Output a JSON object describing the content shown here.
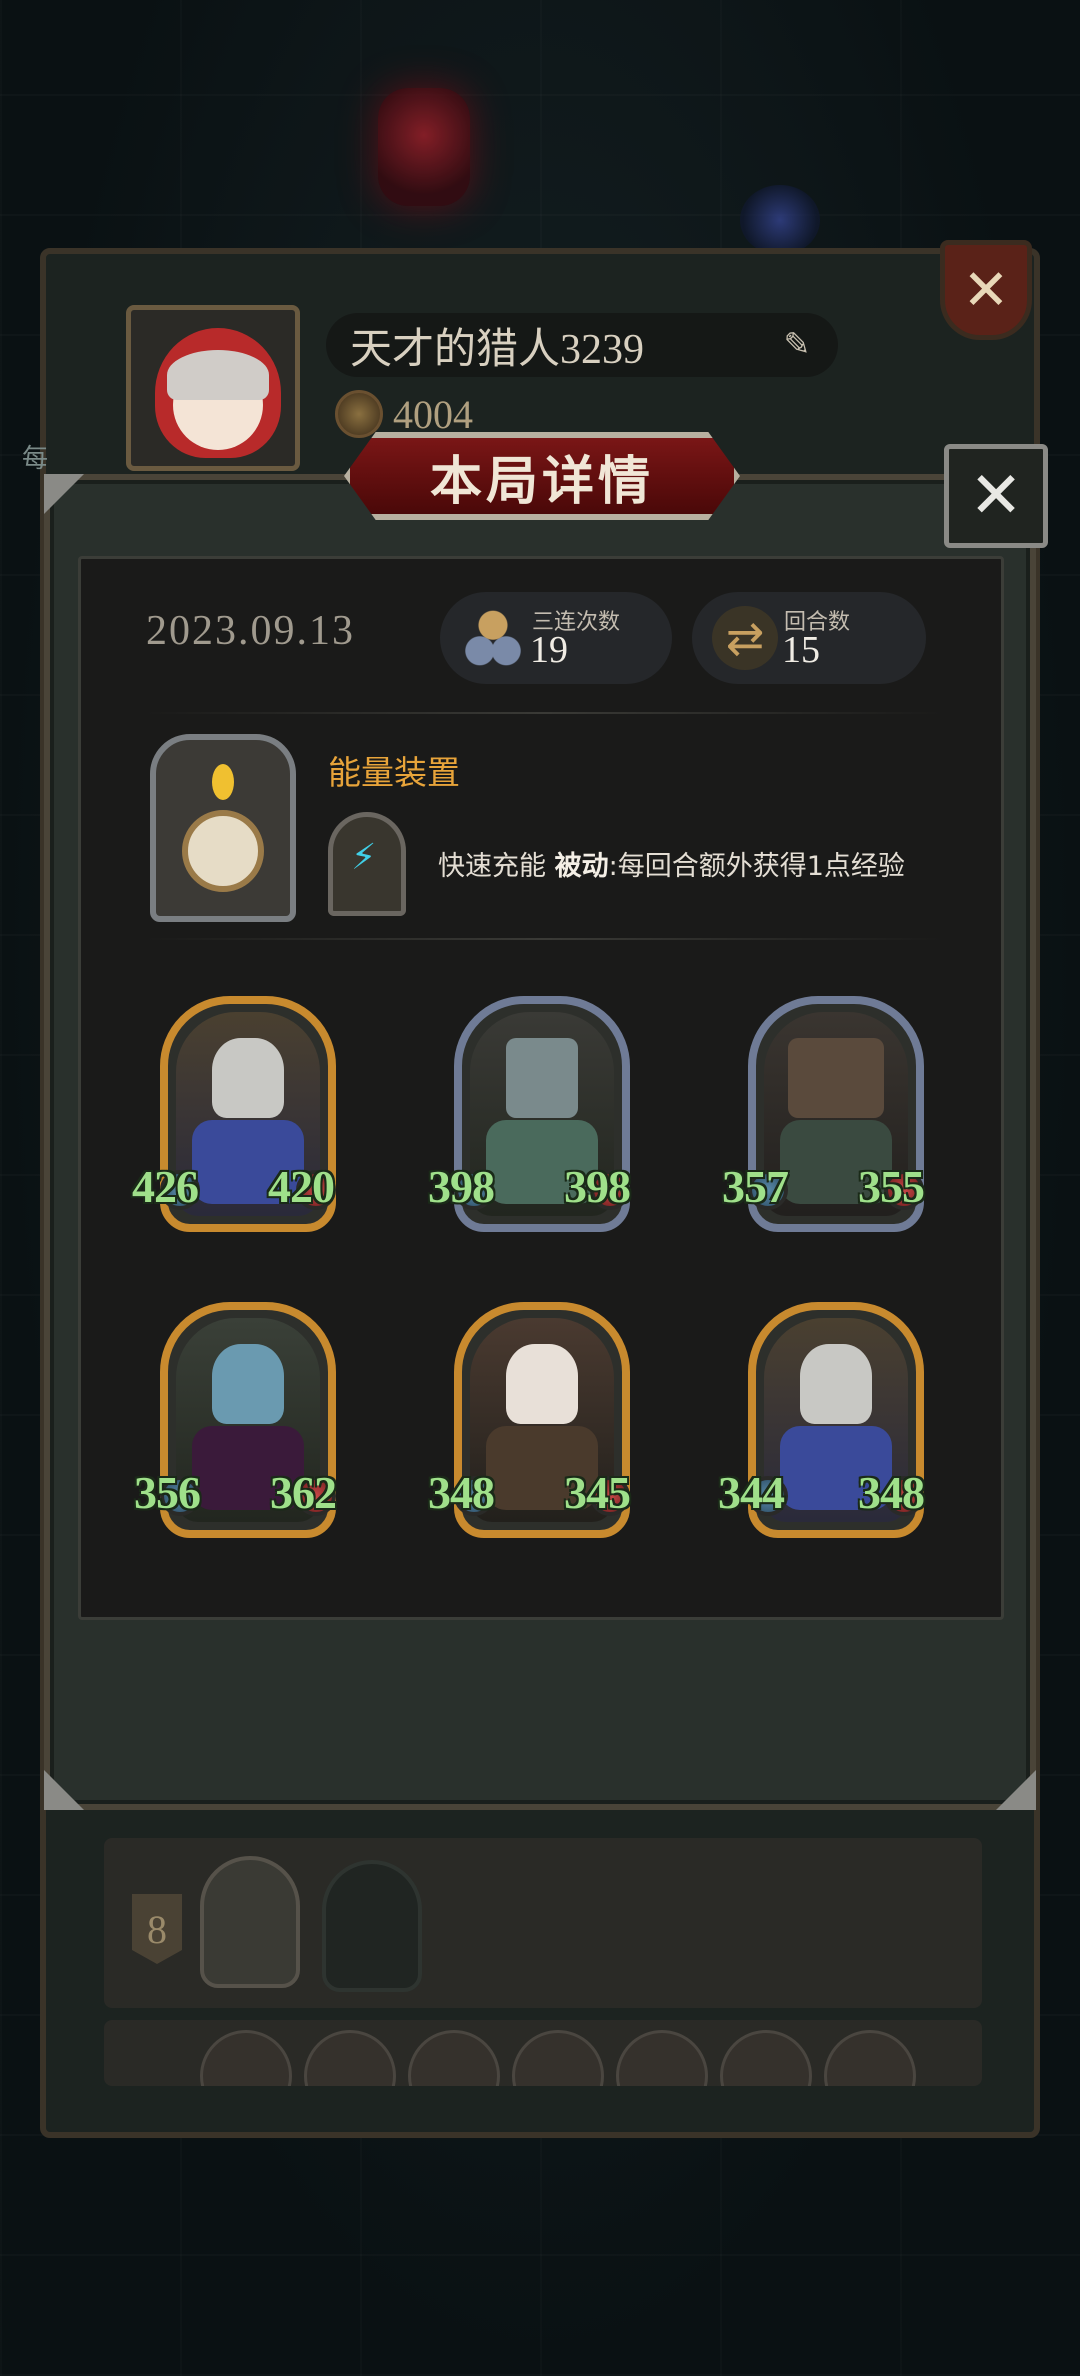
{
  "profile": {
    "player_name": "天才的猎人3239",
    "coins": "4004",
    "side_hint": "每"
  },
  "dialog": {
    "title": "本局详情",
    "date": "2023.09.13",
    "stats": [
      {
        "label": "三连次数",
        "value": "19",
        "icon": "triple-merge-icon"
      },
      {
        "label": "回合数",
        "value": "15",
        "icon": "round-cycle-icon"
      }
    ],
    "device": {
      "title": "能量装置",
      "skill_name": "快速充能",
      "skill_type": "被动",
      "skill_desc": ":每回合额外获得1点经验"
    },
    "units": [
      {
        "attack": "426",
        "health": "420",
        "frame": "gold",
        "art": "armored-knight"
      },
      {
        "attack": "398",
        "health": "398",
        "frame": "silver",
        "art": "iron-golem"
      },
      {
        "attack": "357",
        "health": "355",
        "frame": "silver",
        "art": "treasure-chest-monster"
      },
      {
        "attack": "356",
        "health": "362",
        "frame": "gold",
        "art": "blue-haired-elf"
      },
      {
        "attack": "348",
        "health": "345",
        "frame": "gold",
        "art": "rabbit-masked-rogue"
      },
      {
        "attack": "344",
        "health": "348",
        "frame": "gold",
        "art": "armored-knight"
      }
    ]
  },
  "lineup": {
    "level_badge": "8"
  },
  "colors": {
    "accent_gold": "#c88a2e",
    "accent_orange": "#e8a43a",
    "stat_green": "#9fe08a",
    "banner_red": "#7a1616"
  }
}
